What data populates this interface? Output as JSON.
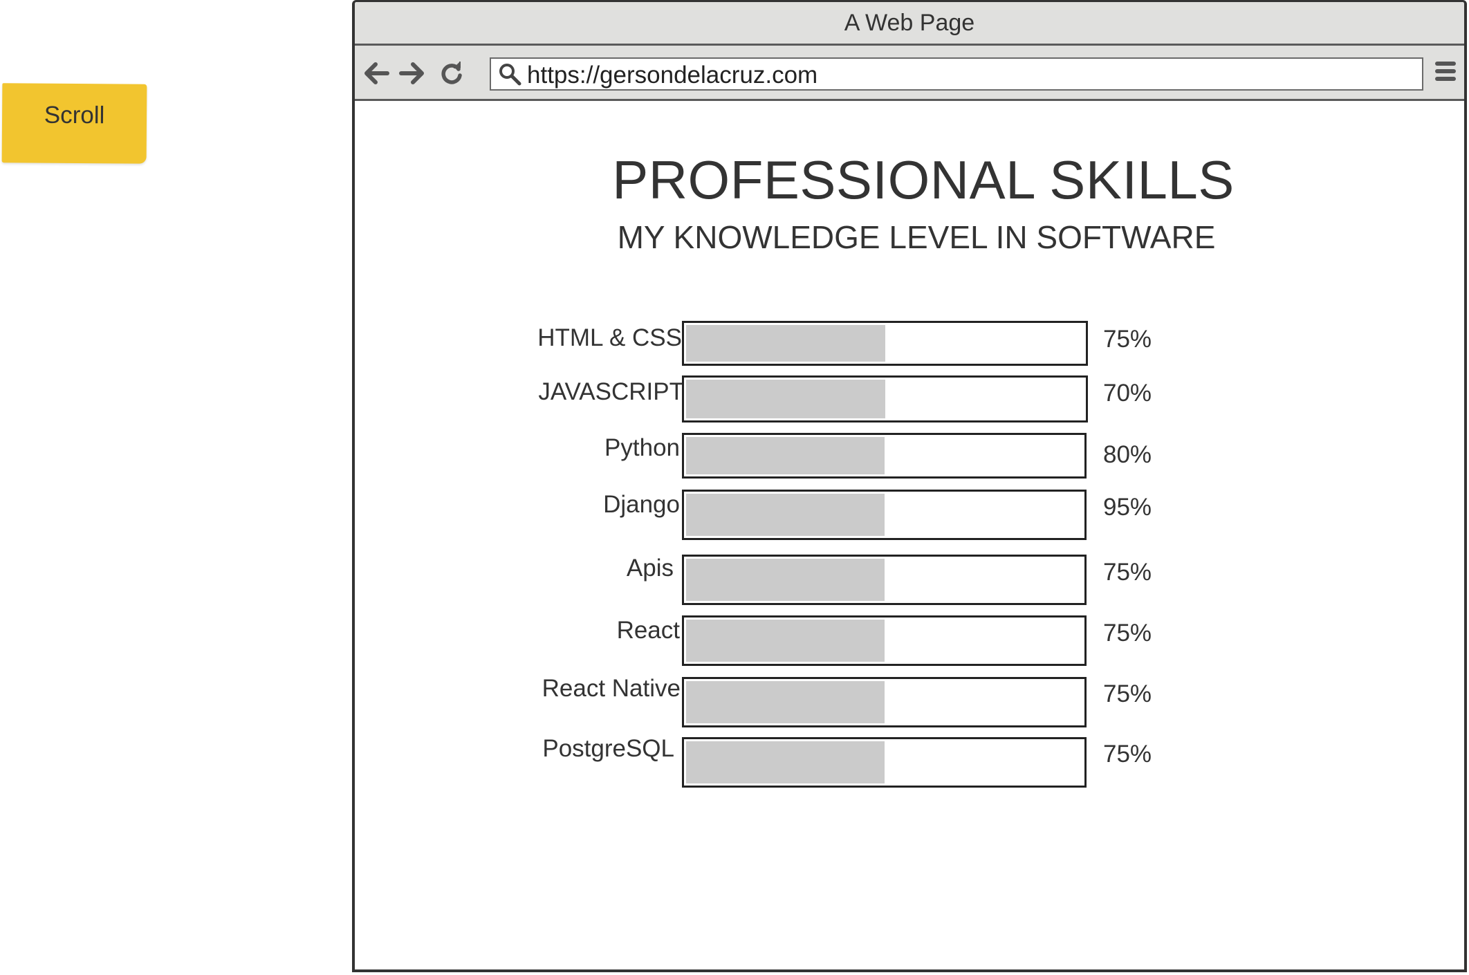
{
  "sticky_note": {
    "label": "Scroll"
  },
  "window": {
    "title": "A Web Page"
  },
  "toolbar": {
    "url": "https://gersondelacruz.com"
  },
  "page": {
    "title": "PROFESSIONAL SKILLS",
    "subtitle": "MY KNOWLEDGE LEVEL IN SOFTWARE"
  },
  "skills": [
    {
      "name": "HTML & CSS",
      "percent_label": "75%",
      "fill": 0.5
    },
    {
      "name": "JAVASCRIPT",
      "percent_label": "70%",
      "fill": 0.5
    },
    {
      "name": "Python",
      "percent_label": "80%",
      "fill": 0.5
    },
    {
      "name": "Django",
      "percent_label": "95%",
      "fill": 0.5
    },
    {
      "name": "Apis",
      "percent_label": "75%",
      "fill": 0.5
    },
    {
      "name": "React",
      "percent_label": "75%",
      "fill": 0.5
    },
    {
      "name": "React Native",
      "percent_label": "75%",
      "fill": 0.5
    },
    {
      "name": "PostgreSQL",
      "percent_label": "75%",
      "fill": 0.5
    }
  ],
  "colors": {
    "sticky": "#f2c52f",
    "chrome": "#e0e0de",
    "bar_fill": "#cbcbcb"
  }
}
